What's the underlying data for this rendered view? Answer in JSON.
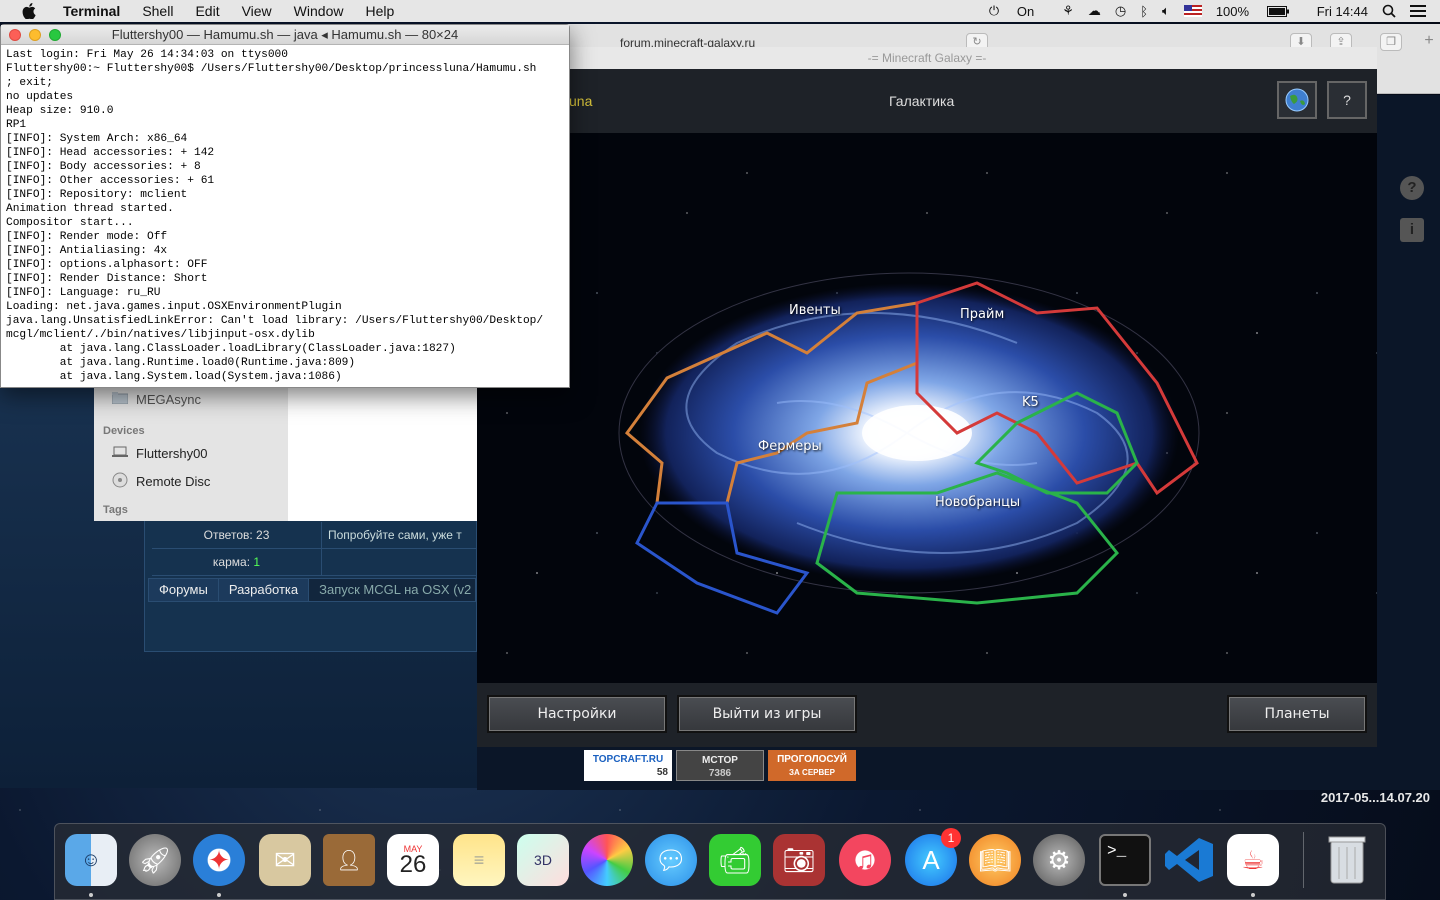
{
  "menubar": {
    "app": "Terminal",
    "items": [
      "Shell",
      "Edit",
      "View",
      "Window",
      "Help"
    ],
    "status": {
      "power": "On",
      "battery": "100%",
      "clock": "Fri 14:44"
    }
  },
  "safari": {
    "url": "forum.minecraft-galaxy.ru"
  },
  "terminal": {
    "title": "Fluttershy00 — Hamumu.sh — java ◂ Hamumu.sh — 80×24",
    "lines": [
      "Last login: Fri May 26 14:34:03 on ttys000",
      "Fluttershy00:~ Fluttershy00$ /Users/Fluttershy00/Desktop/princessluna/Hamumu.sh",
      "; exit;",
      "no updates",
      "Heap size: 910.0",
      "RP1",
      "[INFO]: System Arch: x86_64",
      "[INFO]: Head accessories: + 142",
      "[INFO]: Body accessories: + 8",
      "[INFO]: Other accessories: + 61",
      "[INFO]: Repository: mclient",
      "Animation thread started.",
      "Compositor start...",
      "[INFO]: Render mode: Off",
      "[INFO]: Antialiasing: 4x",
      "[INFO]: options.alphasort: OFF",
      "[INFO]: Render Distance: Short",
      "[INFO]: Language: ru_RU",
      "Loading: net.java.games.input.OSXEnvironmentPlugin",
      "java.lang.UnsatisfiedLinkError: Can't load library: /Users/Fluttershy00/Desktop/",
      "mcgl/mclient/./bin/natives/libjinput-osx.dylib",
      "        at java.lang.ClassLoader.loadLibrary(ClassLoader.java:1827)",
      "        at java.lang.Runtime.load0(Runtime.java:809)",
      "        at java.lang.System.load(System.java:1086)"
    ]
  },
  "finder": {
    "mega": "MEGAsync",
    "devices_header": "Devices",
    "device1": "Fluttershy00",
    "device2": "Remote Disc",
    "tags_header": "Tags"
  },
  "forum": {
    "answers": "Ответов: 23",
    "karma_label": "карма: ",
    "karma_value": "1",
    "post_snippet": "Попробуйте сами, уже т",
    "breadcrumbs": [
      "Форумы",
      "Разработка"
    ],
    "topic": "Запуск MCGL на OSX (v2"
  },
  "game": {
    "window_title": "-= Minecraft Galaxy =-",
    "player_partial": "una",
    "top_title": "Галактика",
    "help_button": "?",
    "sectors": {
      "events": "Ивенты",
      "prime": "Прайм",
      "k5": "K5",
      "farmers": "Фермеры",
      "newbies": "Новобранцы"
    },
    "buttons": {
      "settings": "Настройки",
      "exit": "Выйти из игры",
      "planets": "Планеты"
    }
  },
  "badges": {
    "topcraft": "TOPCRAFT.RU",
    "topcraft_count": "58",
    "mctop": "MCTOP",
    "mctop_count": "7386",
    "vote": "ПРОГОЛОСУЙ",
    "vote_sub": "ЗА СЕРВЕР"
  },
  "desktop": {
    "file_label": "2017-05...14.07.20"
  },
  "dock": {
    "calendar_month": "MAY",
    "calendar_day": "26",
    "appstore_badge": "1"
  }
}
